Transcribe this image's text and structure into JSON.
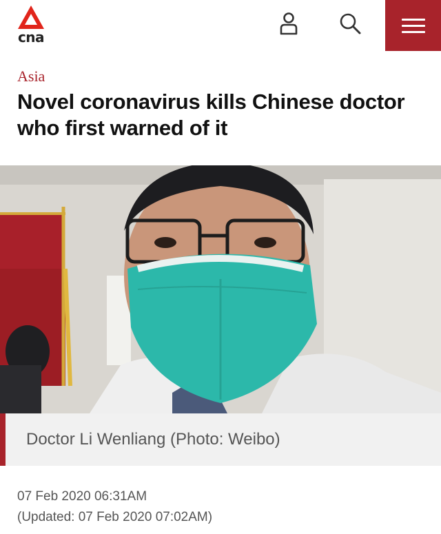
{
  "header": {
    "logo_text": "cna",
    "brand_color": "#a8232b",
    "icons": [
      "user-icon",
      "search-icon",
      "hamburger-menu-icon"
    ]
  },
  "article": {
    "category": "Asia",
    "headline": "Novel coronavirus kills Chinese doctor who first warned of it",
    "photo_caption": "Doctor Li Wenliang (Photo: Weibo)",
    "published": "07 Feb 2020 06:31AM",
    "updated": "(Updated: 07 Feb 2020 07:02AM)"
  }
}
